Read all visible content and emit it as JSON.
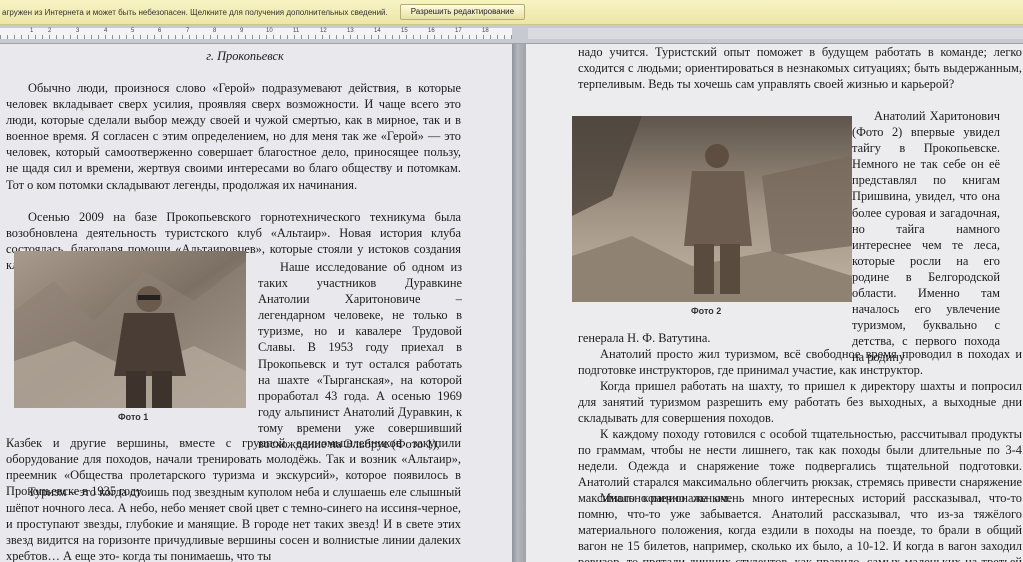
{
  "infobar": {
    "message": "агружен из Интернета и может быть небезопасен. Щелкните для получения дополнительных сведений.",
    "button": "Разрешить редактирование"
  },
  "ruler": {
    "numbers": [
      "1",
      "2",
      "3",
      "4",
      "5",
      "6",
      "7",
      "8",
      "9",
      "10",
      "11",
      "12",
      "13",
      "14",
      "15",
      "16",
      "17",
      "18"
    ]
  },
  "left_page": {
    "heading": "г. Прокопьевск",
    "paragraph1": "Обычно люди, произнося слово «Герой» подразумевают действия, в которые человек вкладывает сверх усилия, проявляя сверх возможности. И чаще всего это люди, которые сделали выбор между своей и чужой смертью, как в мирное, так и в военное время. Я согласен с этим определением, но для меня так же «Герой» — это человек, который самоотверженно совершает благостное дело, приносящее пользу, не щадя сил и времени, жертвуя своими интересами во благо обществу и потомкам. Тот о ком потомки складывают легенды, продолжая их начинания.",
    "paragraph2": "Осенью 2009 на базе Прокопьевского горнотехнического техникума была возобновлена деятельность туристского клуб «Альтаир». Новая история клуба состоялась, благодаря помощи «Альтаировцев», которые стояли у истоков создания клуба в 1969 году.",
    "paragraph3": "Наше исследование об одном из таких участников Дуравкине Анатолии Харитоновиче – легендарном человеке, не только в туризме, но и кавалере Трудовой Славы. В 1953 году приехал в Прокопьевск и тут остался работать на шахте «Тырганская», на которой проработал 43 года. А осенью 1969 году альпинист Анатолий Дуравкин, к тому времени уже совершивший восхождение на Эльбрус (Фото 1),",
    "paragraph4": "Казбек и другие вершины, вместе с группой единомышленников закупили оборудование для походов, начали тренировать молодёжь. Так и возник «Альтаир», преемник «Общества пролетарского туризма и экскурсий», которое появилось в Прокопьевске в 1935 году.",
    "paragraph5": "Туризм – это когда стоишь под звездным куполом неба и слушаешь еле слышный шёпот ночного леса. А небо, небо меняет свой цвет с темно-синего на иссиня-черное, и проступают звезды, глубокие и манящие. В городе нет таких звезд! И в свете этих звезд видится на горизонте причудливые вершины сосен и волнистые линии далеких хребтов… А еще это- когда ты понимаешь, что ты",
    "photo_caption": "Фото 1"
  },
  "right_page": {
    "paragraph1": "надо учится. Туристский опыт поможет в будущем работать в команде; легко сходится с людьми; ориентироваться в незнакомых ситуациях; быть выдержанным, терпеливым. Ведь ты хочешь сам управлять своей жизнью и карьерой?",
    "paragraph2": "Анатолий Харитонович (Фото 2) впервые увидел тайгу в Прокопьевске. Немного не так себе он её представлял по книгам Пришвина, увидел, что она более суровая и загадочная, но тайга намного интереснее чем те леса, которые росли на его родине в Белгородской области. Именно там началось его увлечение туризмом, буквально с детства, с первого похода на родину",
    "paragraph2_end": "генерала Н. Ф. Ватутина.",
    "paragraph3": "Анатолий просто жил туризмом, всё свободное время проводил в походах и подготовке инструкторов, где принимал участие, как инструктор.",
    "paragraph4": "Когда пришел работать на шахту, то пришел к директору шахты и попросил для занятий туризмом разрешить ему работать без выходных, а выходные дни складывать для совершения походов.",
    "paragraph5": "К каждому походу готовился с особой тщательностью, рассчитывал продукты по граммам, чтобы не нести лишнего, так как походы были длительные по 3-4 недели. Одежда и снаряжение тоже подвергались тщательной подготовки. Анатолий старался максимально облегчить рюкзак, стремясь привести снаряжение максимально рациональным.",
    "paragraph6": "Много конечно же очень много интересных историй рассказывал, что-то помню, что-то уже забывается. Анатолий рассказывал, что из-за тяжёлого материального положения, когда ездили в походы на поезде, то брали в общий вагон не 15 билетов, например, сколько их было, а 10-12. И когда в вагон заходил ревизор, то прятали лишних студентов, как правило, самых маленьких на третьей полке и прикрывали их рюкзаками. А вообще очень весело и",
    "photo_caption": "Фото 2"
  }
}
